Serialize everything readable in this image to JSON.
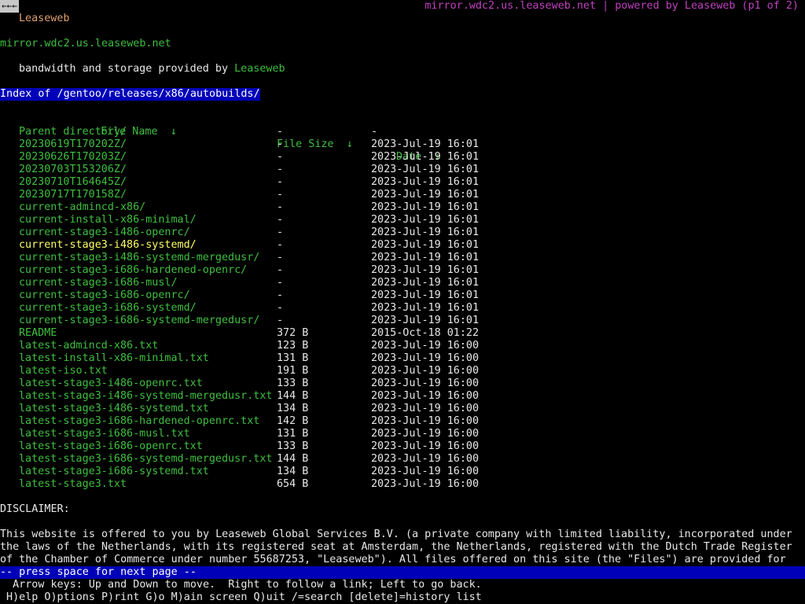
{
  "top": {
    "back_label": "←←←",
    "site_name": "Leaseweb",
    "title_text": "mirror.wdc2.us.leaseweb.net | powered by Leaseweb (p1 of 2)"
  },
  "header": {
    "host": "mirror.wdc2.us.leaseweb.net",
    "provided_prefix": "bandwidth and storage provided by ",
    "provided_link": "Leaseweb",
    "index_title": "Index of /gentoo/releases/x86/autobuilds/"
  },
  "table": {
    "headers": {
      "name": "File Name",
      "name_sort": "↓",
      "size": "File Size",
      "size_sort": "↓",
      "date": "Date",
      "date_sort": "↓"
    },
    "rows": [
      {
        "name": "Parent directory/",
        "size": "-",
        "date": "-"
      },
      {
        "name": "20230619T170202Z/",
        "size": "-",
        "date": "2023-Jul-19 16:01"
      },
      {
        "name": "20230626T170203Z/",
        "size": "-",
        "date": "2023-Jul-19 16:01"
      },
      {
        "name": "20230703T153206Z/",
        "size": "-",
        "date": "2023-Jul-19 16:01"
      },
      {
        "name": "20230710T164645Z/",
        "size": "-",
        "date": "2023-Jul-19 16:01"
      },
      {
        "name": "20230717T170158Z/",
        "size": "-",
        "date": "2023-Jul-19 16:01"
      },
      {
        "name": "current-admincd-x86/",
        "size": "-",
        "date": "2023-Jul-19 16:01"
      },
      {
        "name": "current-install-x86-minimal/",
        "size": "-",
        "date": "2023-Jul-19 16:01"
      },
      {
        "name": "current-stage3-i486-openrc/",
        "size": "-",
        "date": "2023-Jul-19 16:01"
      },
      {
        "name": "current-stage3-i486-systemd/",
        "size": "-",
        "date": "2023-Jul-19 16:01",
        "selected": true
      },
      {
        "name": "current-stage3-i486-systemd-mergedusr/",
        "size": "-",
        "date": "2023-Jul-19 16:01"
      },
      {
        "name": "current-stage3-i686-hardened-openrc/",
        "size": "-",
        "date": "2023-Jul-19 16:01"
      },
      {
        "name": "current-stage3-i686-musl/",
        "size": "-",
        "date": "2023-Jul-19 16:01"
      },
      {
        "name": "current-stage3-i686-openrc/",
        "size": "-",
        "date": "2023-Jul-19 16:01"
      },
      {
        "name": "current-stage3-i686-systemd/",
        "size": "-",
        "date": "2023-Jul-19 16:01"
      },
      {
        "name": "current-stage3-i686-systemd-mergedusr/",
        "size": "-",
        "date": "2023-Jul-19 16:01"
      },
      {
        "name": "README",
        "size": "372 B",
        "date": "2015-Oct-18 01:22"
      },
      {
        "name": "latest-admincd-x86.txt",
        "size": "123 B",
        "date": "2023-Jul-19 16:00"
      },
      {
        "name": "latest-install-x86-minimal.txt",
        "size": "131 B",
        "date": "2023-Jul-19 16:00"
      },
      {
        "name": "latest-iso.txt",
        "size": "191 B",
        "date": "2023-Jul-19 16:00"
      },
      {
        "name": "latest-stage3-i486-openrc.txt",
        "size": "133 B",
        "date": "2023-Jul-19 16:00"
      },
      {
        "name": "latest-stage3-i486-systemd-mergedusr.txt",
        "size": "144 B",
        "date": "2023-Jul-19 16:00"
      },
      {
        "name": "latest-stage3-i486-systemd.txt",
        "size": "134 B",
        "date": "2023-Jul-19 16:00"
      },
      {
        "name": "latest-stage3-i686-hardened-openrc.txt",
        "size": "142 B",
        "date": "2023-Jul-19 16:00"
      },
      {
        "name": "latest-stage3-i686-musl.txt",
        "size": "131 B",
        "date": "2023-Jul-19 16:00"
      },
      {
        "name": "latest-stage3-i686-openrc.txt",
        "size": "133 B",
        "date": "2023-Jul-19 16:00"
      },
      {
        "name": "latest-stage3-i686-systemd-mergedusr.txt",
        "size": "144 B",
        "date": "2023-Jul-19 16:00"
      },
      {
        "name": "latest-stage3-i686-systemd.txt",
        "size": "134 B",
        "date": "2023-Jul-19 16:00"
      },
      {
        "name": "latest-stage3.txt",
        "size": "654 B",
        "date": "2023-Jul-19 16:00"
      }
    ]
  },
  "disclaimer": {
    "heading": "DISCLAIMER:",
    "lines": [
      "This website is offered to you by Leaseweb Global Services B.V. (a private company with limited liability, incorporated under",
      "the laws of the Netherlands, with its registered seat at Amsterdam, the Netherlands, registered with the Dutch Trade Register",
      "of the Chamber of Commerce under number 55687253, \"Leaseweb\"). All files offered on this site (the \"Files\") are provided for"
    ]
  },
  "status": {
    "next_page": "-- press space for next page --",
    "help_line1": "  Arrow keys: Up and Down to move.  Right to follow a link; Left to go back.",
    "help_line2": " H)elp O)ptions P)rint G)o M)ain screen Q)uit /=search [delete]=history list"
  },
  "colors": {
    "link": "#3fbf3f",
    "selected_link": "#ffff66",
    "title": "#c040c0",
    "highlight_bar": "#0000b8",
    "background": "#000000"
  }
}
